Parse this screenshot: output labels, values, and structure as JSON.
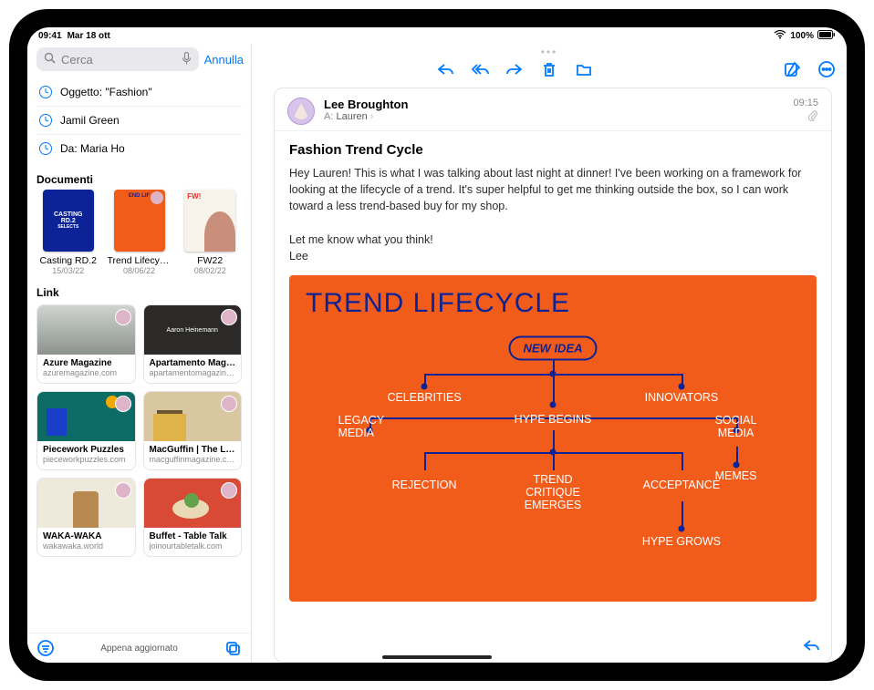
{
  "status": {
    "time": "09:41",
    "date": "Mar 18 ott",
    "battery": "100%"
  },
  "accent": "#007aff",
  "search": {
    "placeholder": "Cerca",
    "cancel": "Annulla"
  },
  "suggestions": [
    {
      "label": "Oggetto: \"Fashion\""
    },
    {
      "label": "Jamil Green"
    },
    {
      "label": "Da: Maria Ho"
    }
  ],
  "sections": {
    "docs": "Documenti",
    "links": "Link"
  },
  "documents": [
    {
      "title": "Casting RD.2",
      "date": "15/03/22",
      "bg": "#0b2396",
      "label1": "CASTING",
      "label2": "RD.2",
      "label3": "SELECTS"
    },
    {
      "title": "Trend Lifecycle",
      "date": "08/06/22",
      "bg": "#f25c1b",
      "label1": "END LIF",
      "label2": "",
      "label3": ""
    },
    {
      "title": "FW22",
      "date": "08/02/22",
      "bg": "#f7f2ea",
      "label1": "FW!",
      "label2": "",
      "label3": ""
    }
  ],
  "links": [
    {
      "title": "Azure Magazine",
      "url": "azuremagazine.com",
      "bg": "#9aa8a2"
    },
    {
      "title": "Apartamento Maga…",
      "url": "apartamentomagazine.c…",
      "bg": "#2b2a28",
      "caption": "Aaron Heinemann"
    },
    {
      "title": "Piecework Puzzles",
      "url": "pieceworkpuzzles.com",
      "bg": "#0d6b66"
    },
    {
      "title": "MacGuffin | The Life",
      "url": "macguffinmagazine.com",
      "bg": "#d8c7a0"
    },
    {
      "title": "WAKA-WAKA",
      "url": "wakawaka.world",
      "bg": "#efe9dc"
    },
    {
      "title": "Buffet - Table Talk",
      "url": "joinourtabletalk.com",
      "bg": "#d94a36"
    }
  ],
  "sidebarFooter": {
    "status": "Appena aggiornato"
  },
  "message": {
    "sender": "Lee Broughton",
    "toLabel": "A:",
    "to": "Lauren",
    "time": "09:15",
    "subject": "Fashion Trend Cycle",
    "p1": "Hey Lauren! This is what I was talking about last night at dinner! I've been working on a framework for looking at the lifecycle of a trend. It's super helpful to get me thinking outside the box, so I can work toward a less trend-based buy for my shop.",
    "p2": "Let me know what you think!",
    "p3": "Lee"
  },
  "attachment": {
    "title": "TREND LIFECYCLE",
    "nodes": {
      "newIdea": "NEW IDEA",
      "celebrities": "CELEBRITIES",
      "innovators": "INNOVATORS",
      "legacyMedia": "LEGACY\nMEDIA",
      "hypeBegins": "HYPE BEGINS",
      "socialMedia": "SOCIAL\nMEDIA",
      "memes": "MEMES",
      "rejection": "REJECTION",
      "trendCritique": "TREND\nCRITIQUE\nEMERGES",
      "acceptance": "ACCEPTANCE",
      "hypeGrows": "HYPE GROWS"
    }
  }
}
